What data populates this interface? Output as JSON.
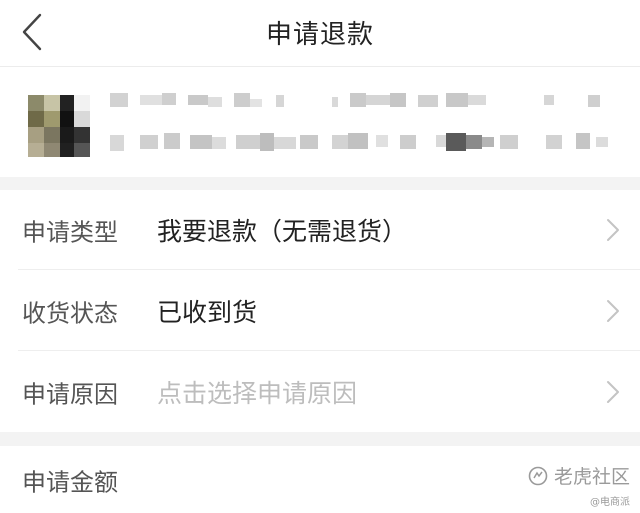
{
  "header": {
    "title": "申请退款",
    "back_icon": "back-arrow-icon"
  },
  "form": {
    "rows": [
      {
        "label": "申请类型",
        "value": "我要退款（无需退货）",
        "placeholder": false
      },
      {
        "label": "收货状态",
        "value": "已收到货",
        "placeholder": false
      },
      {
        "label": "申请原因",
        "value": "点击选择申请原因",
        "placeholder": true
      }
    ],
    "amount_label": "申请金额"
  },
  "watermark": {
    "main": "老虎社区",
    "sub": "@电商派"
  },
  "colors": {
    "background": "#ffffff",
    "section_gap": "#f3f3f3",
    "label_text": "#555555",
    "value_text": "#222222",
    "placeholder_text": "#bdbdbd"
  }
}
